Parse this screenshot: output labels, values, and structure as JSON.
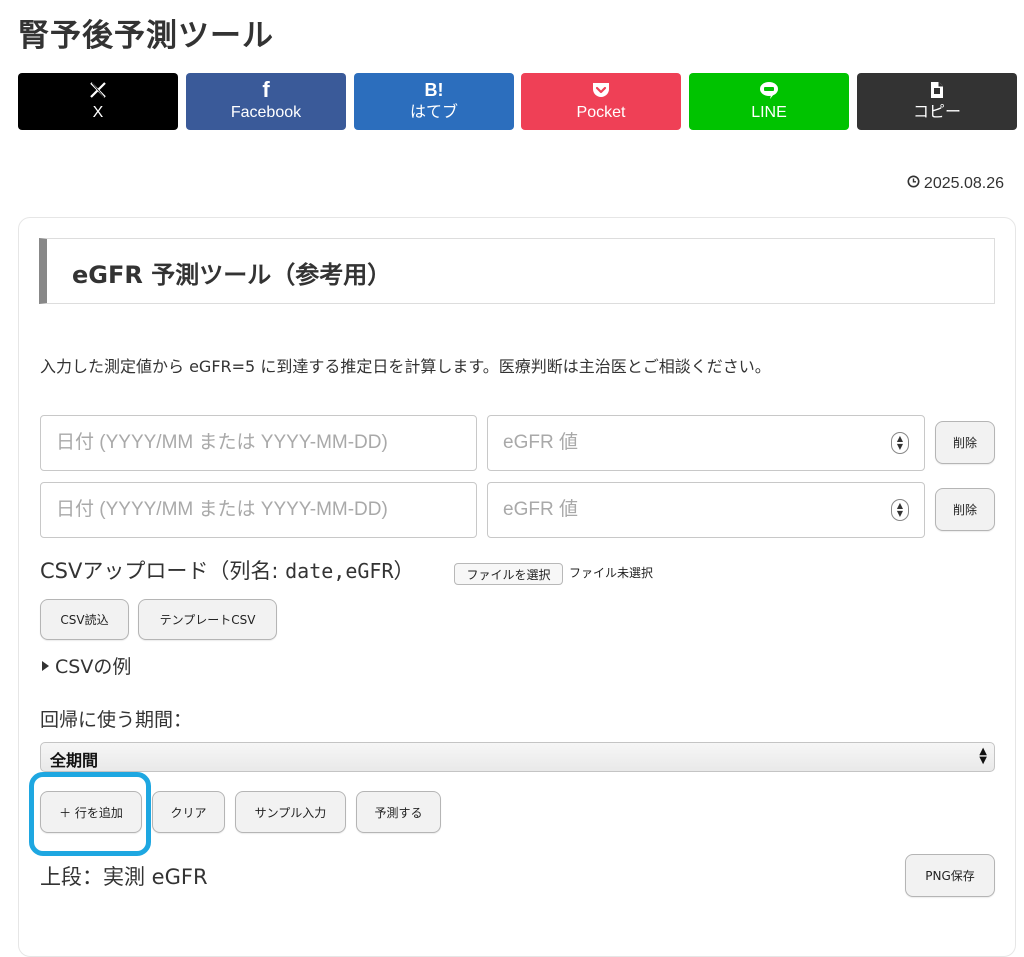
{
  "page": {
    "title": "腎予後予測ツール"
  },
  "share": {
    "x": {
      "icon": "x-logo-icon",
      "label": "X"
    },
    "facebook": {
      "icon": "facebook-icon",
      "label": "Facebook"
    },
    "hatena": {
      "icon": "hatena-bookmark-icon",
      "icon_text": "B!",
      "label": "はてブ"
    },
    "pocket": {
      "icon": "pocket-icon",
      "label": "Pocket"
    },
    "line": {
      "icon": "line-icon",
      "label": "LINE"
    },
    "copy": {
      "icon": "copy-icon",
      "label": "コピー"
    },
    "colors": {
      "x": "#000000",
      "facebook": "#3a5a99",
      "hatena": "#2c6ebd",
      "pocket": "#ef4056",
      "line": "#00c300",
      "copy": "#333333"
    }
  },
  "post": {
    "date": "2025.08.26",
    "date_icon": "clock-icon"
  },
  "tool": {
    "heading": "eGFR 予測ツール（参考用）",
    "description": "入力した測定値から eGFR=5 に到達する推定日を計算します。医療判断は主治医とご相談ください。",
    "rows": [
      {
        "date_placeholder": "日付 (YYYY/MM または YYYY-MM-DD)",
        "egfr_placeholder": "eGFR 値",
        "delete_label": "削除"
      },
      {
        "date_placeholder": "日付 (YYYY/MM または YYYY-MM-DD)",
        "egfr_placeholder": "eGFR 値",
        "delete_label": "削除"
      }
    ],
    "csv": {
      "label_prefix": "CSVアップロード（列名: ",
      "label_columns": "date,eGFR",
      "label_suffix": "）",
      "file_button": "ファイルを選択",
      "file_status": "ファイル未選択",
      "read_button": "CSV読込",
      "template_button": "テンプレートCSV",
      "example_summary": "CSVの例"
    },
    "period": {
      "label": "回帰に使う期間：",
      "selected": "全期間"
    },
    "actions": {
      "add_row": "＋ 行を追加",
      "clear": "クリア",
      "sample": "サンプル入力",
      "predict": "予測する"
    },
    "result": {
      "label": "上段：実測 eGFR",
      "png_button": "PNG保存"
    },
    "highlight_color": "#1ea7e1"
  }
}
